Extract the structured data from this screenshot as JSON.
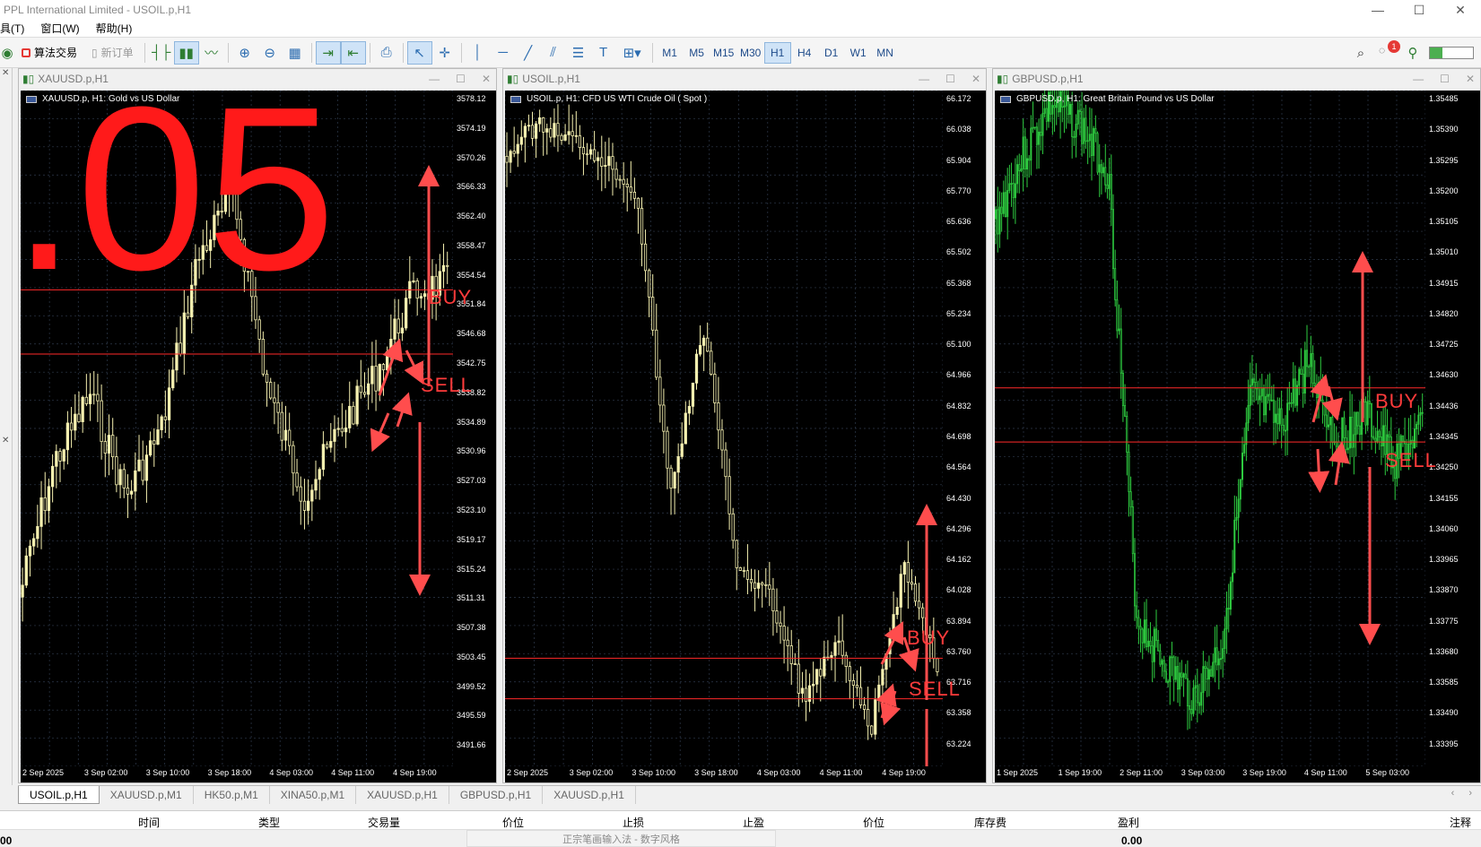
{
  "window": {
    "title": "PPL International Limited - USOIL.p,H1",
    "controls": [
      "—",
      "☐",
      "✕"
    ]
  },
  "menu": [
    "具(T)",
    "窗口(W)",
    "帮助(H)"
  ],
  "toolbar": {
    "algo_trading": "算法交易",
    "new_order": "新订单",
    "timeframes": [
      "M1",
      "M5",
      "M15",
      "M30",
      "H1",
      "H4",
      "D1",
      "W1",
      "MN"
    ],
    "active_timeframe": "H1",
    "notification_count": "1",
    "signal_strength": 0.3
  },
  "charts": [
    {
      "id": "xau",
      "window_title": "XAUUSD.p,H1",
      "label": "XAUUSD.p, H1:  Gold vs US Dollar",
      "prices": [
        "3578.12",
        "3574.19",
        "3570.26",
        "3566.33",
        "3562.40",
        "3558.47",
        "3554.54",
        "3551.84",
        "3546.68",
        "3542.75",
        "3538.82",
        "3534.89",
        "3530.96",
        "3527.03",
        "3523.10",
        "3519.17",
        "3515.24",
        "3511.31",
        "3507.38",
        "3503.45",
        "3499.52",
        "3495.59",
        "3491.66"
      ],
      "times": [
        "2 Sep 2025",
        "3 Sep 02:00",
        "3 Sep 10:00",
        "3 Sep 18:00",
        "4 Sep 03:00",
        "4 Sep 11:00",
        "4 Sep 19:00"
      ],
      "big_text": ".05",
      "buy": "BUY",
      "sell": "SELL"
    },
    {
      "id": "oil",
      "window_title": "USOIL.p,H1",
      "label": "USOIL.p, H1:  CFD US WTI Crude Oil ( Spot )",
      "prices": [
        "66.172",
        "66.038",
        "65.904",
        "65.770",
        "65.636",
        "65.502",
        "65.368",
        "65.234",
        "65.100",
        "64.966",
        "64.832",
        "64.698",
        "64.564",
        "64.430",
        "64.296",
        "64.162",
        "64.028",
        "63.894",
        "63.760",
        "63.716",
        "63.358",
        "63.224"
      ],
      "times": [
        "2 Sep 2025",
        "3 Sep 02:00",
        "3 Sep 10:00",
        "3 Sep 18:00",
        "4 Sep 03:00",
        "4 Sep 11:00",
        "4 Sep 19:00"
      ],
      "buy": "BUY",
      "sell": "SELL"
    },
    {
      "id": "gbp",
      "window_title": "GBPUSD.p,H1",
      "label": "GBPUSD.p, H1:  Great Britain Pound vs US Dollar",
      "prices": [
        "1.35485",
        "1.35390",
        "1.35295",
        "1.35200",
        "1.35105",
        "1.35010",
        "1.34915",
        "1.34820",
        "1.34725",
        "1.34630",
        "1.34436",
        "1.34345",
        "1.34250",
        "1.34155",
        "1.34060",
        "1.33965",
        "1.33870",
        "1.33775",
        "1.33680",
        "1.33585",
        "1.33490",
        "1.33395"
      ],
      "times": [
        "1 Sep 2025",
        "1 Sep 19:00",
        "2 Sep 11:00",
        "3 Sep 03:00",
        "3 Sep 19:00",
        "4 Sep 11:00",
        "5 Sep 03:00"
      ],
      "buy": "BUY",
      "sell": "SELL"
    }
  ],
  "tabs": [
    "USOIL.p,H1",
    "XAUUSD.p,M1",
    "HK50.p,M1",
    "XINA50.p,M1",
    "XAUUSD.p,H1",
    "GBPUSD.p,H1",
    "XAUUSD.p,H1"
  ],
  "trade_columns": [
    "时间",
    "类型",
    "交易量",
    "价位",
    "止损",
    "止盈",
    "价位",
    "库存费",
    "盈利",
    "注释"
  ],
  "ime_text": "正宗笔画输入法 - 数字风格",
  "bottom_values": [
    "00",
    "0.00"
  ]
}
